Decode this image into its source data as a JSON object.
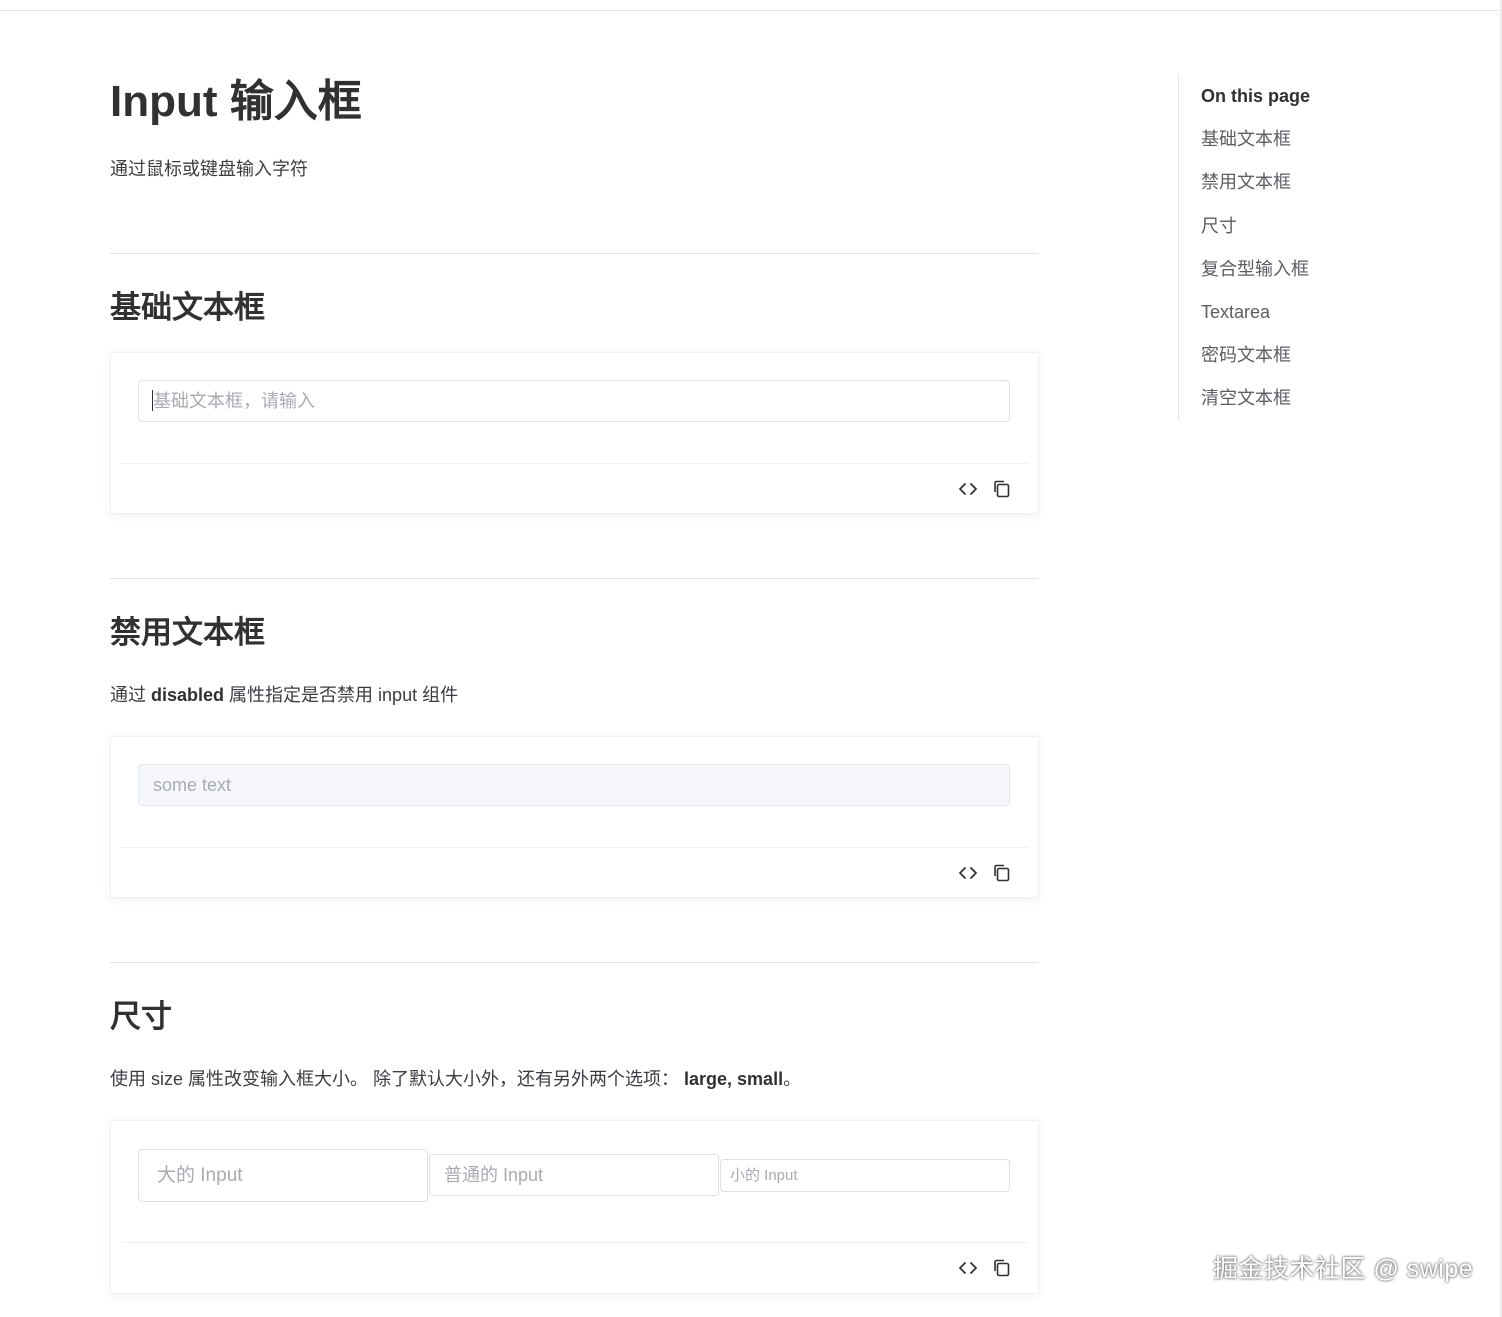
{
  "page": {
    "title": "Input 输入框",
    "description": "通过鼠标或键盘输入字符"
  },
  "sections": [
    {
      "title": "基础文本框",
      "inputs": [
        {
          "placeholder": "基础文本框，请输入",
          "value": ""
        }
      ]
    },
    {
      "title": "禁用文本框",
      "desc_prefix": "通过 ",
      "desc_bold": "disabled",
      "desc_suffix": " 属性指定是否禁用 input 组件",
      "inputs": [
        {
          "placeholder": "",
          "value": "some text",
          "disabled": true
        }
      ]
    },
    {
      "title": "尺寸",
      "desc_prefix": "使用 size 属性改变输入框大小。 除了默认大小外，还有另外两个选项： ",
      "desc_bold": "large, small",
      "desc_suffix": "。",
      "inputs": [
        {
          "placeholder": "大的 Input",
          "size": "large"
        },
        {
          "placeholder": "普通的 Input",
          "size": "default"
        },
        {
          "placeholder": "小的 Input",
          "size": "small"
        }
      ]
    }
  ],
  "toolbar": {
    "code_icon": "code-icon",
    "copy_icon": "copy-icon"
  },
  "toc": {
    "title": "On this page",
    "items": [
      "基础文本框",
      "禁用文本框",
      "尺寸",
      "复合型输入框",
      "Textarea",
      "密码文本框",
      "清空文本框"
    ]
  },
  "watermark": "掘金技术社区 @ swipe",
  "colors": {
    "text": "#303133",
    "border": "#dcdfe6",
    "disabled_bg": "#f5f7fa",
    "placeholder": "#a8abb2"
  }
}
